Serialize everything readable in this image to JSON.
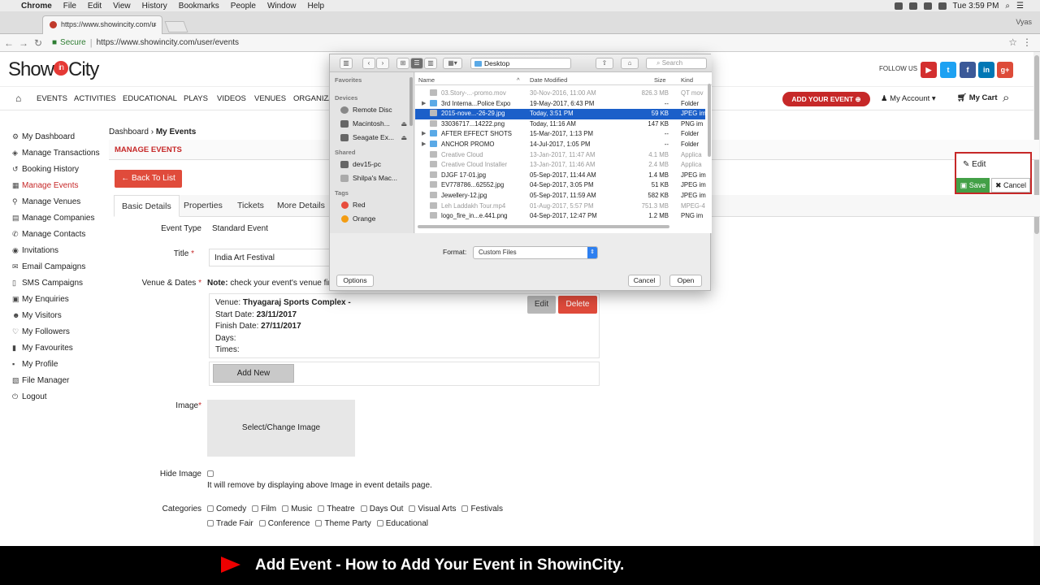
{
  "macos": {
    "menus": [
      "Chrome",
      "File",
      "Edit",
      "View",
      "History",
      "Bookmarks",
      "People",
      "Window",
      "Help"
    ],
    "clock": "Tue 3:59 PM"
  },
  "browser": {
    "tab_title": "https://www.showincity.com/u",
    "user": "Vyas",
    "secure": "Secure",
    "url": "https://www.showincity.com/user/events"
  },
  "site": {
    "logo": "ShowCity",
    "logo_in": "in",
    "follow_us": "FOLLOW US",
    "social": [
      "You Tube",
      "Twitter",
      "Facebook",
      "LinkedIn",
      "Google+"
    ],
    "nav": [
      "EVENTS",
      "ACTIVITIES",
      "EDUCATIONAL",
      "PLAYS",
      "VIDEOS",
      "VENUES",
      "ORGANIZA"
    ],
    "add_event": "ADD YOUR EVENT ⊕",
    "my_account": "My Account",
    "my_cart": "My Cart"
  },
  "sidebar": {
    "items": [
      {
        "label": "My Dashboard",
        "icon": "dashboard-icon",
        "glyph": "⚙"
      },
      {
        "label": "Manage Transactions",
        "icon": "transactions-icon",
        "glyph": "◈"
      },
      {
        "label": "Booking History",
        "icon": "history-icon",
        "glyph": "↺"
      },
      {
        "label": "Manage Events",
        "icon": "calendar-icon",
        "glyph": "▦"
      },
      {
        "label": "Manage Venues",
        "icon": "location-icon",
        "glyph": "⚲"
      },
      {
        "label": "Manage Companies",
        "icon": "building-icon",
        "glyph": "▤"
      },
      {
        "label": "Manage Contacts",
        "icon": "phone-icon",
        "glyph": "✆"
      },
      {
        "label": "Invitations",
        "icon": "eye-icon",
        "glyph": "◉"
      },
      {
        "label": "Email Campaigns",
        "icon": "envelope-icon",
        "glyph": "✉"
      },
      {
        "label": "SMS Campaigns",
        "icon": "sms-icon",
        "glyph": "▯"
      },
      {
        "label": "My Enquiries",
        "icon": "enquiries-icon",
        "glyph": "▣"
      },
      {
        "label": "My Visitors",
        "icon": "users-icon",
        "glyph": "☻"
      },
      {
        "label": "My Followers",
        "icon": "heart-icon",
        "glyph": "♡"
      },
      {
        "label": "My Favourites",
        "icon": "bookmark-icon",
        "glyph": "▮"
      },
      {
        "label": "My Profile",
        "icon": "user-icon",
        "glyph": "▪"
      },
      {
        "label": "File Manager",
        "icon": "folder-icon",
        "glyph": "▧"
      },
      {
        "label": "Logout",
        "icon": "power-icon",
        "glyph": "⏻"
      }
    ],
    "active_index": 3
  },
  "breadcrumb": {
    "root": "Dashboard",
    "current": "My Events"
  },
  "manage_events": "MANAGE EVENTS",
  "back_to_list": "Back To List",
  "tabs": [
    "Basic Details",
    "Properties",
    "Tickets",
    "More Details"
  ],
  "form": {
    "event_type_label": "Event Type",
    "event_type_value": "Standard Event",
    "title_label": "Title",
    "title_value": "India Art Festival",
    "venue_label": "Venue & Dates",
    "note_bold": "Note:",
    "note_text": "check your event's venue fin",
    "venue_prefix": "Venue: ",
    "venue_name": "Thyagaraj Sports Complex -",
    "start_prefix": "Start Date: ",
    "start_date": "23/11/2017",
    "finish_prefix": "Finish Date: ",
    "finish_date": "27/11/2017",
    "days_label": "Days:",
    "times_label": "Times:",
    "edit": "Edit",
    "delete": "Delete",
    "add_new": "Add New",
    "image_label": "Image",
    "select_image": "Select/Change Image",
    "hide_image_label": "Hide Image",
    "hide_image_help": "It will remove by displaying above Image in event details page.",
    "categories_label": "Categories",
    "categories_row1": [
      "Comedy",
      "Film",
      "Music",
      "Theatre",
      "Days Out",
      "Visual Arts",
      "Festivals"
    ],
    "categories_row2": [
      "Trade Fair",
      "Conference",
      "Theme Party",
      "Educational"
    ]
  },
  "edit_panel": {
    "edit": "Edit",
    "save": "Save",
    "cancel": "Cancel"
  },
  "dialog": {
    "location": "Desktop",
    "search": "Search",
    "sections": {
      "favorites": "Favorites",
      "devices": "Devices",
      "shared": "Shared",
      "tags": "Tags"
    },
    "devices": [
      "Remote Disc",
      "Macintosh...",
      "Seagate Ex..."
    ],
    "shared": [
      "dev15-pc",
      "Shilpa's Mac..."
    ],
    "tags": [
      {
        "label": "Red",
        "color": "#e74c3c"
      },
      {
        "label": "Orange",
        "color": "#f39c12"
      }
    ],
    "columns": {
      "name": "Name",
      "date": "Date Modified",
      "size": "Size",
      "kind": "Kind"
    },
    "files": [
      {
        "name": "03.Story-...-promo.mov",
        "date": "30-Nov-2016, 11:00 AM",
        "size": "826.3 MB",
        "kind": "QT mov",
        "type": "file",
        "dim": true
      },
      {
        "name": "3rd Interna...Police Expo",
        "date": "19-May-2017, 6:43 PM",
        "size": "--",
        "kind": "Folder",
        "type": "folder"
      },
      {
        "name": "2015-nove...-26-29.jpg",
        "date": "Today, 3:51 PM",
        "size": "59 KB",
        "kind": "JPEG im",
        "type": "file",
        "selected": true
      },
      {
        "name": "33036717...14222.png",
        "date": "Today, 11:16 AM",
        "size": "147 KB",
        "kind": "PNG im",
        "type": "file"
      },
      {
        "name": "AFTER EFFECT SHOTS",
        "date": "15-Mar-2017, 1:13 PM",
        "size": "--",
        "kind": "Folder",
        "type": "folder"
      },
      {
        "name": "ANCHOR PROMO",
        "date": "14-Jul-2017, 1:05 PM",
        "size": "--",
        "kind": "Folder",
        "type": "folder"
      },
      {
        "name": "Creative Cloud",
        "date": "13-Jan-2017, 11:47 AM",
        "size": "4.1 MB",
        "kind": "Applica",
        "type": "file",
        "dim": true
      },
      {
        "name": "Creative Cloud Installer",
        "date": "13-Jan-2017, 11:46 AM",
        "size": "2.4 MB",
        "kind": "Applica",
        "type": "file",
        "dim": true
      },
      {
        "name": "DJGF 17-01.jpg",
        "date": "05-Sep-2017, 11:44 AM",
        "size": "1.4 MB",
        "kind": "JPEG im",
        "type": "file"
      },
      {
        "name": "EV778786...62552.jpg",
        "date": "04-Sep-2017, 3:05 PM",
        "size": "51 KB",
        "kind": "JPEG im",
        "type": "file"
      },
      {
        "name": "Jewellery-12.jpg",
        "date": "05-Sep-2017, 11:59 AM",
        "size": "582 KB",
        "kind": "JPEG im",
        "type": "file"
      },
      {
        "name": "Leh Laddakh Tour.mp4",
        "date": "01-Aug-2017, 5:57 PM",
        "size": "751.3 MB",
        "kind": "MPEG-4",
        "type": "file",
        "dim": true
      },
      {
        "name": "logo_fire_in...e.441.png",
        "date": "04-Sep-2017, 12:47 PM",
        "size": "1.2 MB",
        "kind": "PNG im",
        "type": "file"
      }
    ],
    "format_label": "Format:",
    "format_value": "Custom Files",
    "options": "Options",
    "cancel": "Cancel",
    "open": "Open"
  },
  "banner": {
    "text": "Add Event - How to Add Your Event in ShowinCity."
  }
}
